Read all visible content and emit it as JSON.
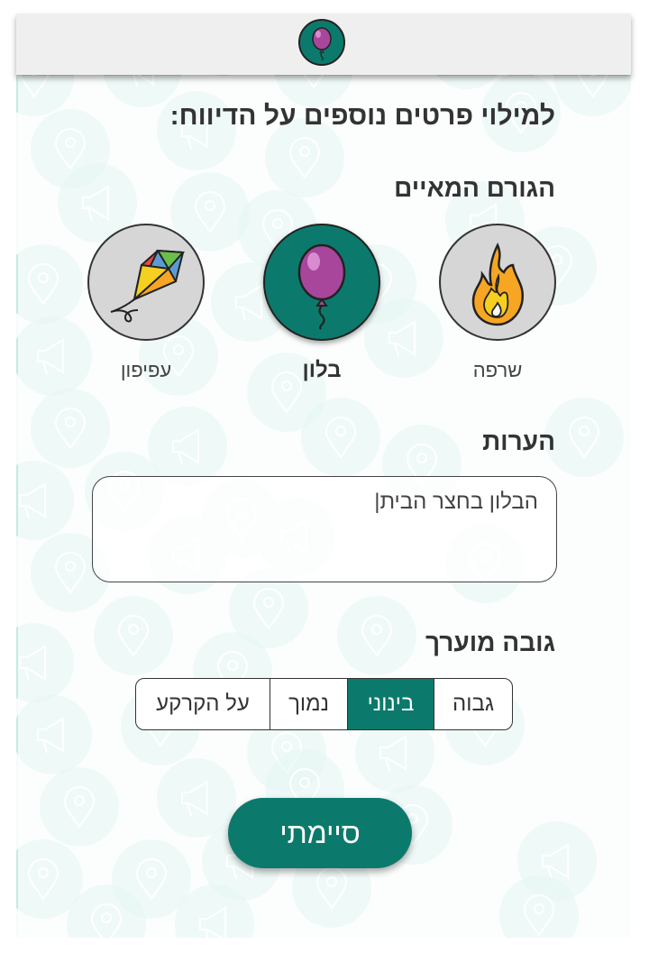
{
  "header": {
    "logo_icon": "balloon-icon"
  },
  "form": {
    "title": "למילוי פרטים נוספים על הדיווח:",
    "agent_section_label": "הגורם המאיים",
    "agents": [
      {
        "id": "fire",
        "label": "שרפה",
        "icon": "fire-icon",
        "selected": false
      },
      {
        "id": "balloon",
        "label": "בלון",
        "icon": "balloon-icon",
        "selected": true
      },
      {
        "id": "kite",
        "label": "עפיפון",
        "icon": "kite-icon",
        "selected": false
      }
    ],
    "notes_label": "הערות",
    "notes_value": "הבלון בחצר הבית|",
    "height_label": "גובה מוערך",
    "height_options": [
      "גבוה",
      "בינוני",
      "נמוך",
      "על הקרקע"
    ],
    "height_selected": "בינוני",
    "done_label": "סיימתי"
  },
  "colors": {
    "accent": "#0b7a6c",
    "balloon": "#a8469c",
    "background_pins": "#9fdcd4"
  }
}
